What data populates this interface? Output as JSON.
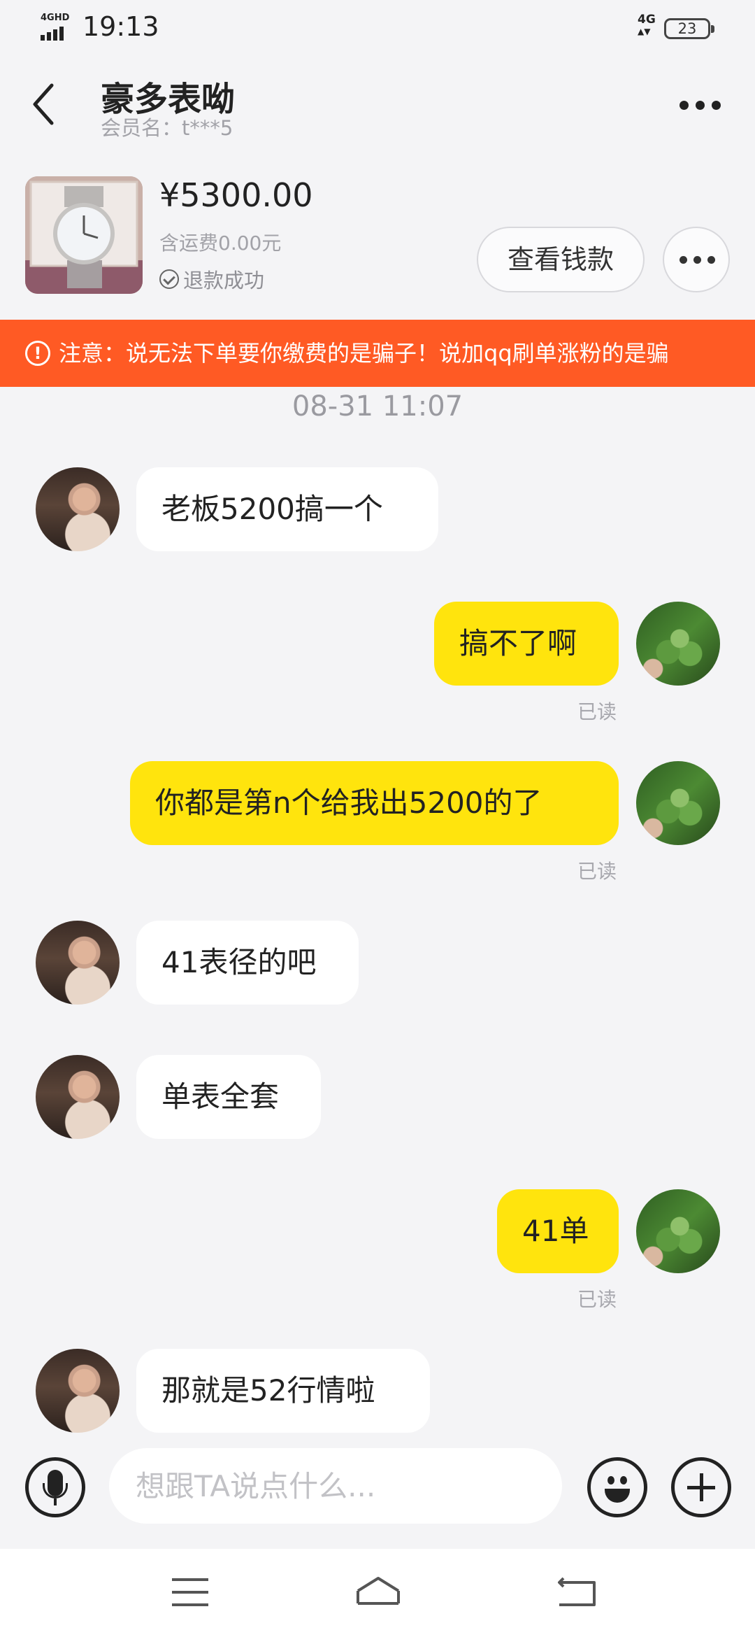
{
  "status_bar": {
    "network": "4GHD",
    "time": "19:13",
    "signal_right": "4G",
    "battery": "23"
  },
  "header": {
    "title": "豪多表呦",
    "subtitle": "会员名：t***5"
  },
  "product": {
    "price": "¥5300.00",
    "shipping": "含运费0.00元",
    "status": "退款成功",
    "view_money_label": "查看钱款"
  },
  "warning": {
    "text": "注意：说无法下单要你缴费的是骗子！说加qq刷单涨粉的是骗"
  },
  "chat": {
    "timestamp": "08-31 11:07",
    "messages": [
      {
        "side": "left",
        "text": "老板5200搞一个"
      },
      {
        "side": "right",
        "text": "搞不了啊",
        "status": "已读"
      },
      {
        "side": "right",
        "text": "你都是第n个给我出5200的了",
        "status": "已读"
      },
      {
        "side": "left",
        "text": "41表径的吧"
      },
      {
        "side": "left",
        "text": "单表全套"
      },
      {
        "side": "right",
        "text": "41单",
        "status": "已读"
      },
      {
        "side": "left",
        "text": "那就是52行情啦"
      }
    ]
  },
  "input": {
    "placeholder": "想跟TA说点什么..."
  },
  "icons": {
    "back": "back-chevron-icon",
    "more": "more-dots-icon",
    "mic": "microphone-icon",
    "emoji": "emoji-icon",
    "plus": "plus-icon",
    "refund_check": "check-circle-icon",
    "warning": "warning-circle-icon"
  },
  "colors": {
    "warning_bg": "#ff5a24",
    "my_bubble": "#ffe40d",
    "their_bubble": "#ffffff",
    "page_bg": "#f4f4f6"
  }
}
